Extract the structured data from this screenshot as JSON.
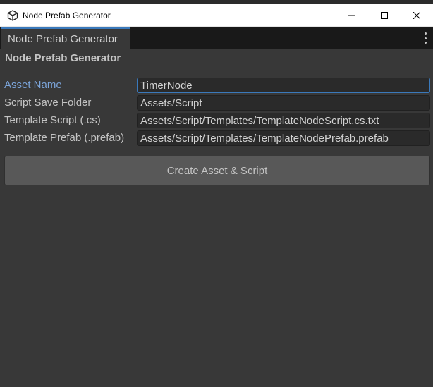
{
  "window": {
    "title": "Node Prefab Generator",
    "controls": {
      "minimize": "minimize-icon",
      "maximize": "maximize-icon",
      "close": "close-icon"
    }
  },
  "tab": {
    "label": "Node Prefab Generator",
    "menu_icon": "kebab-menu-icon"
  },
  "section": {
    "title": "Node Prefab Generator"
  },
  "fields": [
    {
      "label": "Asset Name",
      "value": "TimerNode"
    },
    {
      "label": "Script Save Folder",
      "value": "Assets/Script"
    },
    {
      "label": "Template Script (.cs)",
      "value": "Assets/Script/Templates/TemplateNodeScript.cs.txt"
    },
    {
      "label": "Template Prefab (.prefab)",
      "value": "Assets/Script/Templates/TemplateNodePrefab.prefab"
    }
  ],
  "actions": {
    "create_label": "Create Asset & Script"
  },
  "colors": {
    "background": "#383838",
    "tab_bar": "#191919",
    "accent": "#3a79bb",
    "focused_label": "#7ba4d9",
    "field_bg": "#2a2a2a",
    "button_bg": "#585858",
    "text": "#c4c4c4"
  }
}
